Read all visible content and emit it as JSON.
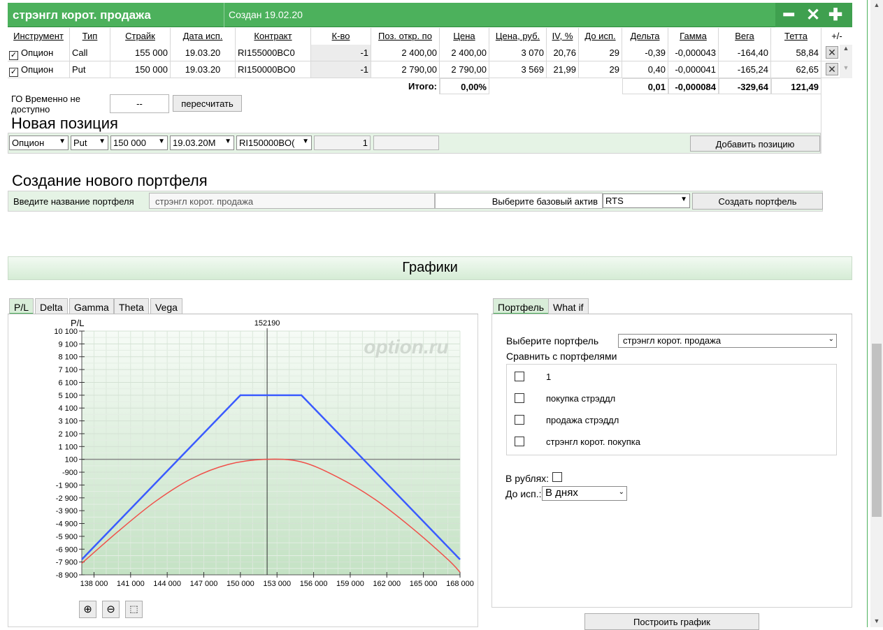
{
  "portfolio": {
    "title": "стрэнгл корот. продажа",
    "created": "Создан 19.02.20",
    "controls": {
      "minimize": "━",
      "close": "✕",
      "add": "✚"
    }
  },
  "table": {
    "headers": [
      "Инструмент",
      "Тип",
      "Страйк",
      "Дата исп.",
      "Контракт",
      "К-во",
      "Поз. откр. по",
      "Цена",
      "Цена, руб.",
      "IV, %",
      "До исп.",
      "Дельта",
      "Гамма",
      "Вега",
      "Тетта",
      "+/-"
    ],
    "rows": [
      {
        "instrument": "Опцион",
        "type": "Call",
        "strike": "155 000",
        "date": "19.03.20",
        "contract": "RI155000BC0",
        "qty": "-1",
        "open": "2 400,00",
        "price": "2 400,00",
        "price_rub": "3 070",
        "iv": "20,76",
        "days": "29",
        "delta": "-0,39",
        "gamma": "-0,000043",
        "vega": "-164,40",
        "theta": "58,84"
      },
      {
        "instrument": "Опцион",
        "type": "Put",
        "strike": "150 000",
        "date": "19.03.20",
        "contract": "RI150000BO0",
        "qty": "-1",
        "open": "2 790,00",
        "price": "2 790,00",
        "price_rub": "3 569",
        "iv": "21,99",
        "days": "29",
        "delta": "0,40",
        "gamma": "-0,000041",
        "vega": "-165,24",
        "theta": "62,65"
      }
    ],
    "totals": {
      "label": "Итого:",
      "pct": "0,00%",
      "delta": "0,01",
      "gamma": "-0,000084",
      "vega": "-329,64",
      "theta": "121,49"
    }
  },
  "go": {
    "label": "ГО Временно не доступно",
    "value": "--",
    "recalc": "пересчитать"
  },
  "new_position": {
    "title": "Новая позиция",
    "instrument": "Опцион",
    "type": "Put",
    "strike": "150 000",
    "date": "19.03.20M",
    "contract": "RI150000BO(",
    "qty": "1",
    "add_button": "Добавить позицию"
  },
  "new_portfolio": {
    "title": "Создание нового портфеля",
    "name_label": "Введите название портфеля",
    "name_value": "стрэнгл корот. продажа",
    "base_label": "Выберите базовый актив",
    "base_value": "RTS",
    "create_button": "Создать портфель"
  },
  "graphs": {
    "title": "Графики",
    "tabs": [
      "P/L",
      "Delta",
      "Gamma",
      "Theta",
      "Vega"
    ],
    "zoom": [
      "zoom-in-icon",
      "zoom-out-icon",
      "zoom-fit-icon"
    ]
  },
  "chart_data": {
    "type": "line",
    "ylabel": "P/L",
    "marker_label": "152190",
    "marker_x": 152190,
    "watermark": "option.ru",
    "xlim": [
      137000,
      168000
    ],
    "ylim": [
      -8900,
      10100
    ],
    "x_ticks": [
      "138 000",
      "141 000",
      "144 000",
      "147 000",
      "150 000",
      "153 000",
      "156 000",
      "159 000",
      "162 000",
      "165 000",
      "168 000"
    ],
    "x_tick_values": [
      138000,
      141000,
      144000,
      147000,
      150000,
      153000,
      156000,
      159000,
      162000,
      165000,
      168000
    ],
    "y_ticks": [
      "10 100",
      "9 100",
      "8 100",
      "7 100",
      "6 100",
      "5 100",
      "4 100",
      "3 100",
      "2 100",
      "1 100",
      "100",
      "-900",
      "-1 900",
      "-2 900",
      "-3 900",
      "-4 900",
      "-5 900",
      "-6 900",
      "-7 900",
      "-8 900"
    ],
    "y_tick_values": [
      10100,
      9100,
      8100,
      7100,
      6100,
      5100,
      4100,
      3100,
      2100,
      1100,
      100,
      -900,
      -1900,
      -2900,
      -3900,
      -4900,
      -5900,
      -6900,
      -7900,
      -8900
    ],
    "series": [
      {
        "color": "#3b5bff",
        "x": [
          137000,
          150000,
          155000,
          168000
        ],
        "y": [
          -7700,
          5100,
          5100,
          -7700
        ]
      },
      {
        "color": "#f0504a",
        "x": [
          137000,
          140000,
          143000,
          146000,
          149000,
          152000,
          155000,
          158000,
          161000,
          164000,
          167000,
          168000
        ],
        "y": [
          -8000,
          -5500,
          -3200,
          -1400,
          -300,
          100,
          -100,
          -1300,
          -3000,
          -5200,
          -7700,
          -8700
        ]
      }
    ]
  },
  "side": {
    "tabs": [
      "Портфель",
      "What if"
    ],
    "select_label": "Выберите портфель",
    "select_value": "стрэнгл корот. продажа",
    "compare_label": "Сравнить с портфелями",
    "compare_items": [
      "1",
      "покупка стрэддл",
      "продажа стрэддл",
      "стрэнгл корот. покупка"
    ],
    "rub_label": "В рублях:",
    "days_label": "До исп.:",
    "days_value": "В днях",
    "build_button": "Построить график"
  }
}
